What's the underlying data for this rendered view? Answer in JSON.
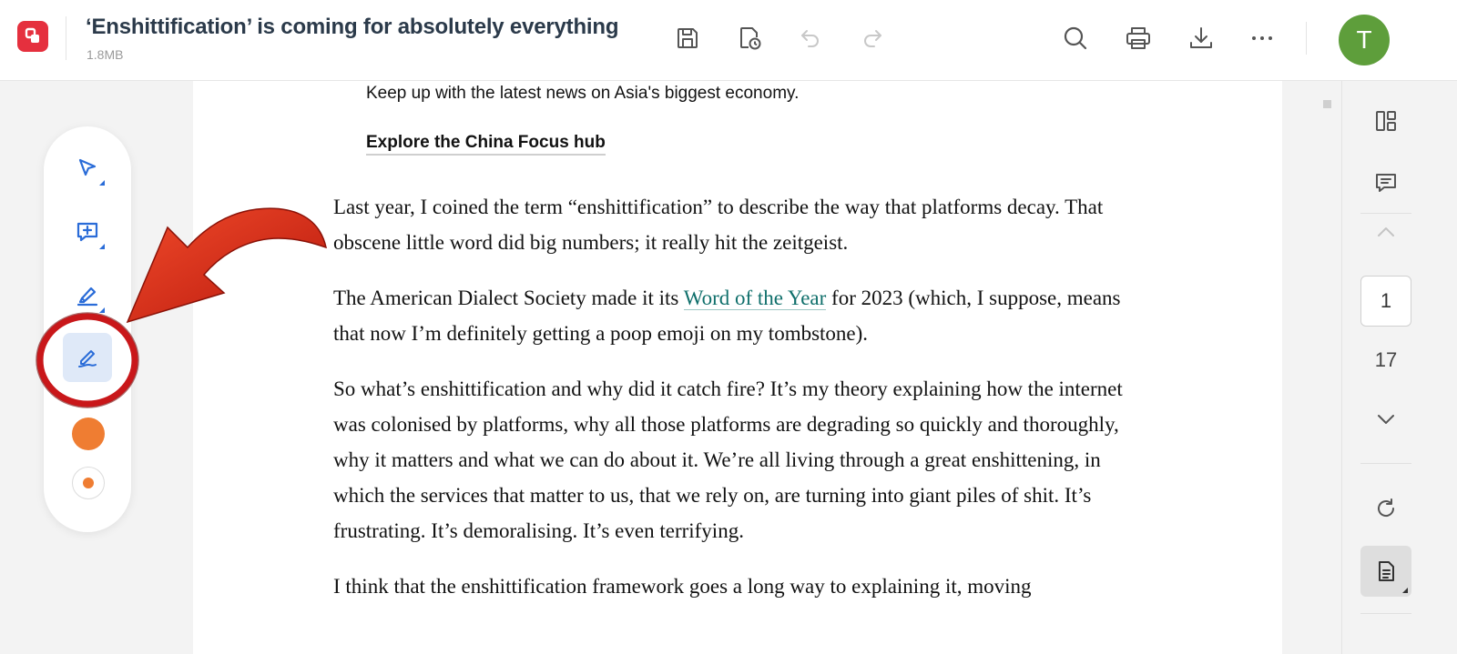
{
  "header": {
    "title": "‘Enshittification’ is coming for absolutely everything",
    "file_size": "1.8MB",
    "avatar_letter": "T"
  },
  "document": {
    "promo_line": "Keep up with the latest news on Asia's biggest economy.",
    "promo_link": "Explore the China Focus hub",
    "p1": "Last year, I coined the term “enshittification” to describe the way that platforms decay. That obscene little word did big numbers; it really hit the zeitgeist.",
    "p2_before": "The American Dialect Society made it its ",
    "p2_link": "Word of the Year",
    "p2_after": " for 2023 (which, I suppose, means that now I’m definitely getting a poop emoji on my tombstone).",
    "p3": "So what’s enshittification and why did it catch fire? It’s my theory explaining how the internet was colonised by platforms, why all those platforms are degrading so quickly and thoroughly, why it matters and what we can do about it. We’re all living through a great enshittening, in which the services that matter to us, that we rely on, are turning into giant piles of shit. It’s frustrating. It’s demoralising. It’s even terrifying.",
    "p4": "I think that the enshittification framework goes a long way to explaining it, moving"
  },
  "toolbar": {
    "pen_color": "#ef7d32",
    "active_tool": "pen-tool"
  },
  "navigation": {
    "current_page": "1",
    "total_pages": "17"
  },
  "colors": {
    "accent": "#2a6cd8",
    "brand": "#e5303e",
    "annotation": "#d42a1a",
    "avatar": "#5e9e3b"
  }
}
